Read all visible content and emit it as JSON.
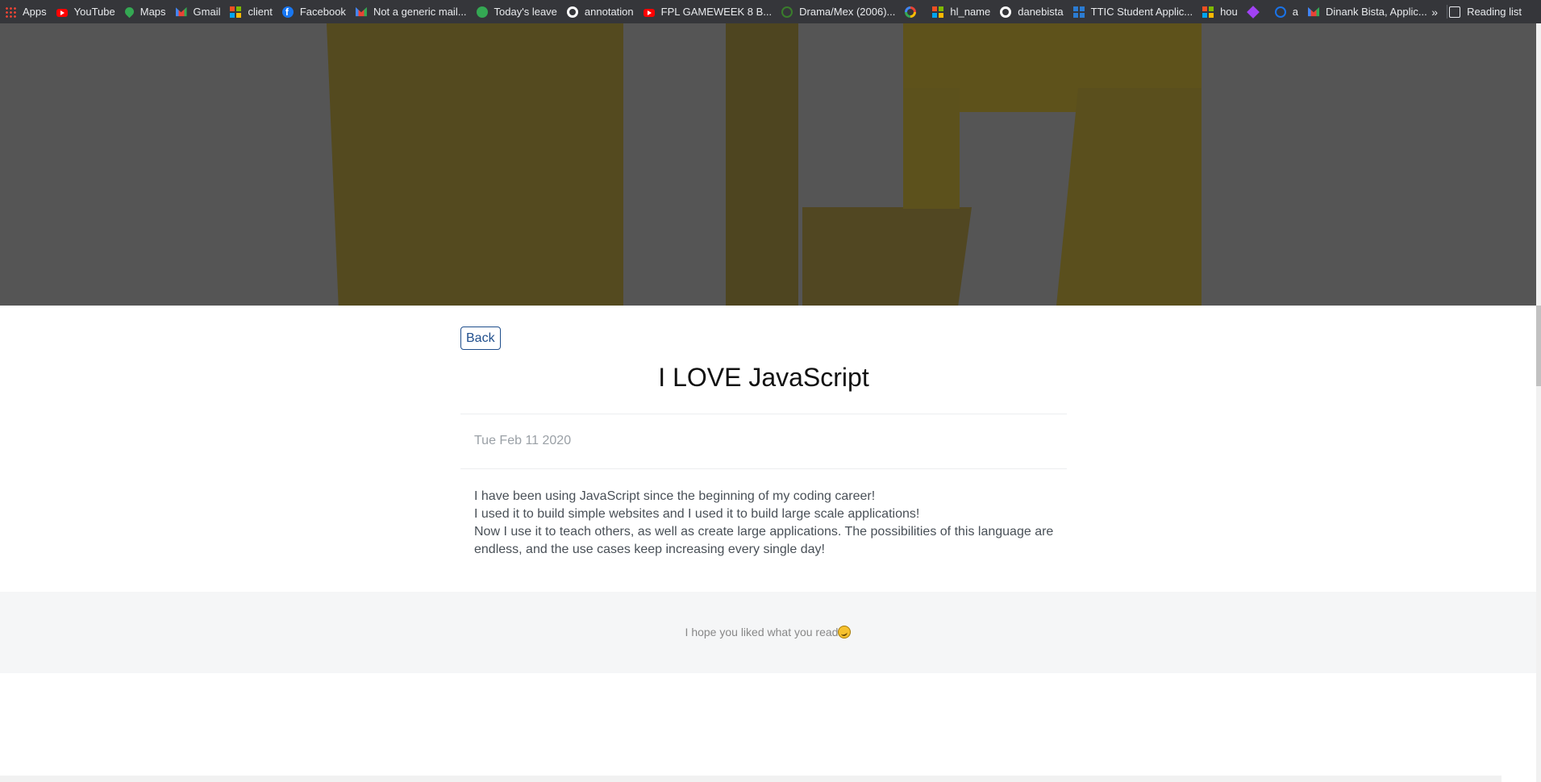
{
  "bookmarks": [
    {
      "label": "Apps",
      "icon": "apps-grid-icon"
    },
    {
      "label": "YouTube",
      "icon": "youtube-icon"
    },
    {
      "label": "Maps",
      "icon": "maps-pin-icon"
    },
    {
      "label": "Gmail",
      "icon": "gmail-icon"
    },
    {
      "label": "client",
      "icon": "microsoft-icon"
    },
    {
      "label": "Facebook",
      "icon": "facebook-icon"
    },
    {
      "label": "Not a generic mail...",
      "icon": "gmail-icon"
    },
    {
      "label": "Today's leave",
      "icon": "green-circle-icon"
    },
    {
      "label": "annotation",
      "icon": "github-icon"
    },
    {
      "label": "FPL GAMEWEEK 8 B...",
      "icon": "youtube-icon"
    },
    {
      "label": "Drama/Mex (2006)...",
      "icon": "leaf-icon"
    },
    {
      "label": "",
      "icon": "google-icon"
    },
    {
      "label": "hl_name",
      "icon": "microsoft-icon"
    },
    {
      "label": "danebista",
      "icon": "github-icon"
    },
    {
      "label": "TTIC Student Applic...",
      "icon": "microsoft-blue-icon"
    },
    {
      "label": "hou",
      "icon": "microsoft-icon"
    },
    {
      "label": "",
      "icon": "diamond-icon"
    },
    {
      "label": "a",
      "icon": "ring-icon"
    },
    {
      "label": "Dinank Bista, Applic...",
      "icon": "gmail-icon"
    }
  ],
  "more_chevron": "»",
  "reading_list": "Reading list",
  "hero": {
    "bg_color": "#555555",
    "accent_color": "#544a1f"
  },
  "post": {
    "back_label": "Back",
    "title": "I LOVE JavaScript",
    "date": "Tue Feb 11 2020",
    "paragraph_lines": [
      "I have been using JavaScript since the beginning of my coding career!",
      "I used it to build simple websites and I used it to build large scale applications!",
      "Now I use it to teach others, as well as create large applications. The possibilities of this language are endless, and the use cases keep increasing every single day!"
    ]
  },
  "footer": {
    "text": "I hope you liked what you read",
    "emoji": "rofl-emoji-icon"
  }
}
